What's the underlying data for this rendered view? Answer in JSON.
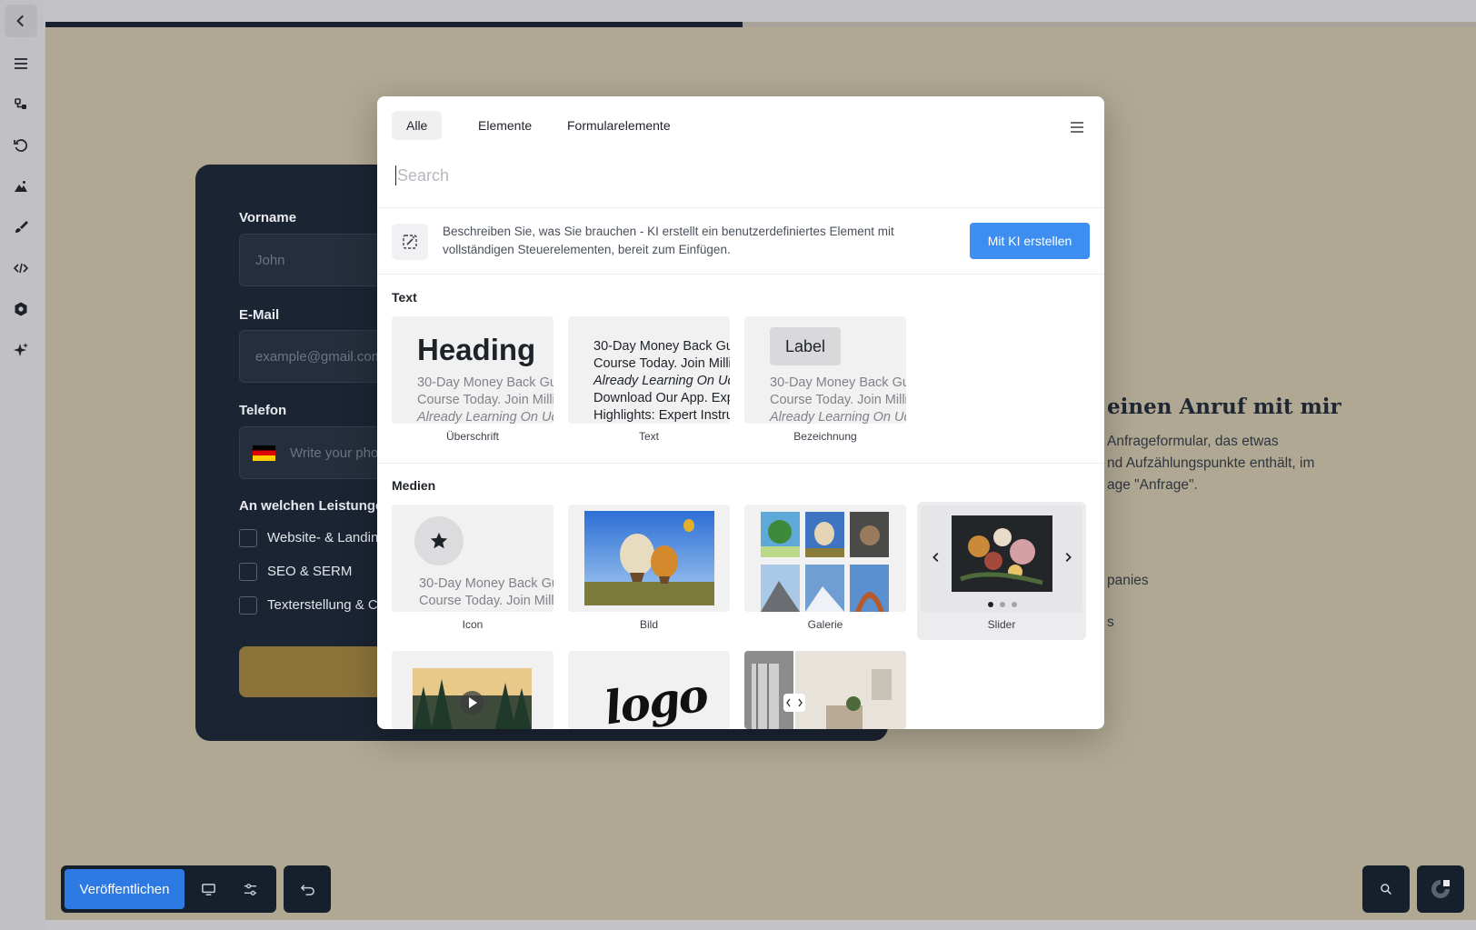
{
  "canvas": {
    "form": {
      "first_name_label": "Vorname",
      "first_name_placeholder": "John",
      "email_label": "E-Mail",
      "email_placeholder": "example@gmail.com",
      "phone_label": "Telefon",
      "phone_placeholder": "Write your phone",
      "services_label": "An welchen Leistungen",
      "services": [
        "Website- & Landin",
        "SEO & SERM",
        "Texterstellung & C"
      ]
    },
    "right": {
      "title": "einen Anruf mit mir",
      "lines": [
        "Anfrageformular, das etwas",
        "nd Aufzählungspunkte enthält, im",
        "age \"Anfrage\"."
      ],
      "fragment1": "panies",
      "fragment2": "s"
    }
  },
  "progress_value": 0.487,
  "toolbar": {
    "publish_label": "Veröffentlichen"
  },
  "modal": {
    "tabs": [
      "Alle",
      "Elemente",
      "Formularelemente"
    ],
    "active_tab": "Alle",
    "search_placeholder": "Search",
    "ai": {
      "description": "Beschreiben Sie, was Sie brauchen - KI erstellt ein benutzerdefiniertes Element mit vollständigen Steuerelementen, bereit zum Einfügen.",
      "button": "Mit KI erstellen"
    },
    "sections": {
      "text": {
        "title": "Text",
        "items": [
          {
            "caption": "Überschrift",
            "heading": "Heading",
            "lines": [
              "30-Day Money Back Gu",
              "Course Today. Join Milli",
              "Already Learning On Ud"
            ]
          },
          {
            "caption": "Text",
            "lines": [
              "30-Day Money Back Gu",
              "Course Today. Join Milli",
              "Already Learning On Ud",
              "Download Our App. Exp",
              "Highlights: Expert Instru"
            ]
          },
          {
            "caption": "Bezeichnung",
            "chip": "Label",
            "lines": [
              "30-Day Money Back Gu",
              "Course Today. Join Milli",
              "Already Learning On Ud"
            ]
          }
        ]
      },
      "media": {
        "title": "Medien",
        "items": [
          {
            "caption": "Icon",
            "lines": [
              "30-Day Money Back Gu",
              "Course Today. Join Mill"
            ]
          },
          {
            "caption": "Bild"
          },
          {
            "caption": "Galerie"
          },
          {
            "caption": "Slider"
          }
        ]
      }
    },
    "logo_text": "logo"
  },
  "colors": {
    "accent": "#3d8ef0",
    "publish": "#2e7ae4",
    "dark_card": "#1b2432",
    "canvas": "#b0a893"
  },
  "icons": [
    "chevron-left-icon",
    "hamburger-icon",
    "layers-icon",
    "history-icon",
    "image-icon",
    "brush-icon",
    "code-icon",
    "settings-icon",
    "sparkle-icon",
    "desktop-icon",
    "sliders-icon",
    "undo-icon",
    "search-icon",
    "brand-icon",
    "ai-wand-icon",
    "star-icon",
    "play-icon"
  ]
}
